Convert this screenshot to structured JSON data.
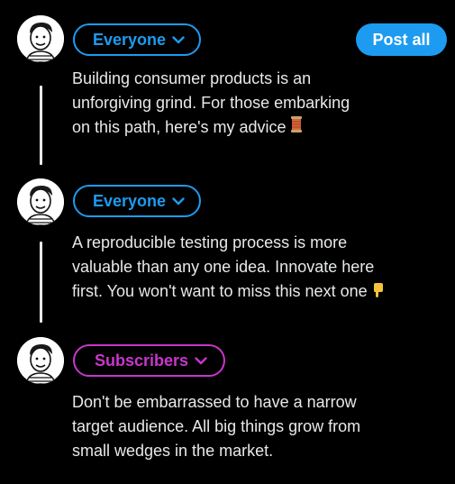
{
  "header": {
    "post_all_label": "Post all"
  },
  "posts": [
    {
      "audience": "Everyone",
      "text": "Building consumer products is an\nunforgiving grind. For those embarking\non this path, here's my advice",
      "emoji": "thread-spool-emoji"
    },
    {
      "audience": "Everyone",
      "text": "A reproducible testing process is more\nvaluable than any one idea. Innovate here\nfirst. You won't want to miss this next one",
      "emoji": "pointing-down-emoji"
    },
    {
      "audience": "Subscribers",
      "text": "Don't be embarrassed to have a narrow\ntarget audience. All big things grow from\nsmall wedges in the market."
    }
  ],
  "colors": {
    "background": "#000000",
    "accent_blue": "#1d9bf0",
    "accent_purple": "#c936cc",
    "text": "#e7e9ea"
  },
  "icons": {
    "audience_dropdown": "chevron-down-icon",
    "avatar": "cartoon-avatar"
  }
}
